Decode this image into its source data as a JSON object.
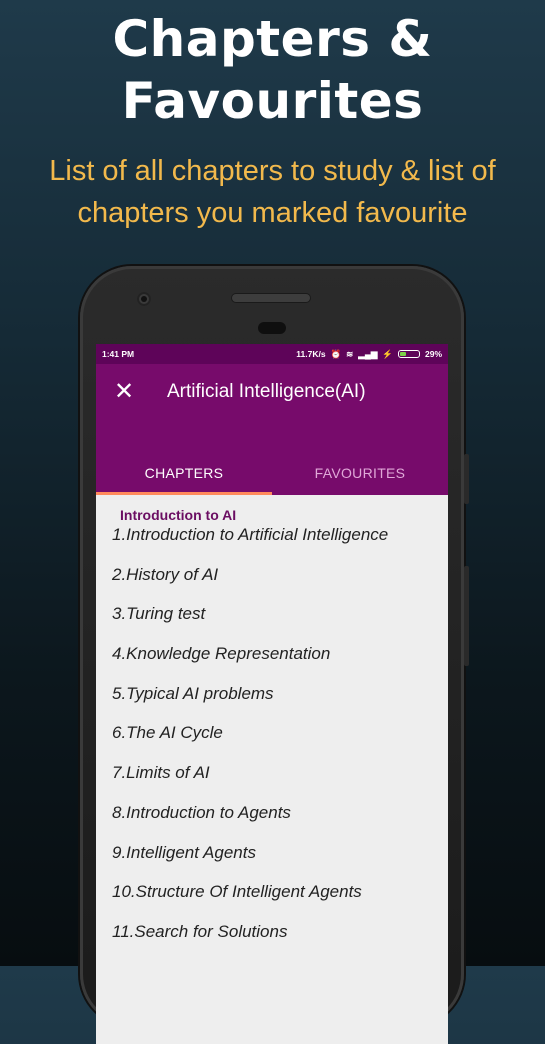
{
  "hero": {
    "title_line1": "Chapters &",
    "title_line2": "Favourites",
    "subtitle_line1": "List of all chapters to study & list of",
    "subtitle_line2": "chapters you marked favourite"
  },
  "status_bar": {
    "time": "1:41 PM",
    "network_speed": "11.7K/s",
    "battery": "29%",
    "icons": [
      "alarm-off-icon",
      "alarm-icon",
      "wifi-icon",
      "signal-icon",
      "charging-icon",
      "battery-icon"
    ]
  },
  "app_bar": {
    "close_icon": "close-icon",
    "title": "Artificial Intelligence(AI)"
  },
  "tabs": [
    {
      "label": "CHAPTERS",
      "active": true
    },
    {
      "label": "FAVOURITES",
      "active": false
    }
  ],
  "colors": {
    "app_bar": "#770b6b",
    "status_bar": "#5e0459",
    "tab_indicator": "#ff8a5c",
    "subtitle": "#f2b94c"
  },
  "section": {
    "title": "Introduction to AI"
  },
  "chapters": [
    "1.Introduction to Artificial Intelligence",
    "2.History of AI",
    "3.Turing test",
    "4.Knowledge Representation",
    "5.Typical AI problems",
    "6.The AI Cycle",
    "7.Limits of AI",
    "8.Introduction to Agents",
    "9.Intelligent Agents",
    "10.Structure Of Intelligent Agents",
    "11.Search for Solutions"
  ]
}
